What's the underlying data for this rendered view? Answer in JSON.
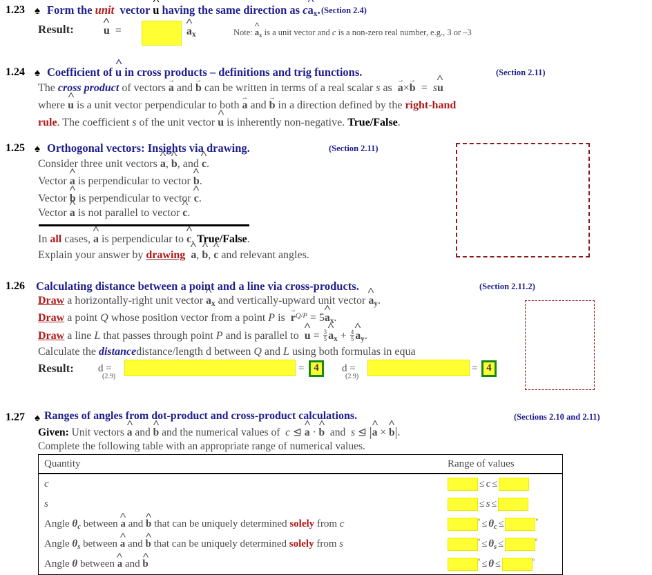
{
  "problems": [
    {
      "number": "1.23",
      "marker": "spade",
      "title_parts": [
        "Form the ",
        "unit",
        " vector ",
        "u",
        " having the same direction as ",
        "c",
        "a",
        "x",
        "."
      ],
      "title_plain": "Form the unit vector û having the same direction as c âx.",
      "section": "(Section 2.4)",
      "result_label": "Result:",
      "u_symbol": "u",
      "equals": "=",
      "ax_symbol": "a",
      "ax_sub": "x",
      "note": "Note:  âx is a unit vector and c is a non-zero real number, e.g., 3 or –3",
      "note_prefix": "Note:",
      "note_mid1": "is a unit vector and",
      "note_c": "c",
      "note_mid2": "is a non-zero real number, e.g., 3 or –3",
      "answer_box": ""
    },
    {
      "number": "1.24",
      "marker": "spade",
      "title_plain": "Coefficient of û in cross products – definitions and trig functions.",
      "title_a": "Coefficient of ",
      "title_u": "u",
      "title_b": " in cross products – definitions and trig functions.",
      "section": "(Section 2.11)",
      "line1_a": "The ",
      "line1_cross": "cross product",
      "line1_b": " of vectors ",
      "line1_c": " and ",
      "line1_d": " can be written in terms of a real scalar ",
      "line1_s": "s",
      "line1_e": " as ",
      "line2_a": "where ",
      "line2_b": " is a unit vector perpendicular to both ",
      "line2_c": " and ",
      "line2_d": " in a direction defined by the ",
      "line2_rh": "right-hand",
      "line3_rule": "rule",
      "line3_a": ".   The coefficient ",
      "line3_s": "s",
      "line3_b": " of the unit vector ",
      "line3_c": " is inherently non-negative.  ",
      "line3_tf": "True/False",
      "line3_period": "."
    },
    {
      "number": "1.25",
      "marker": "spade",
      "title_plain": "Orthogonal vectors:  Insights via drawing.",
      "section": "(Section 2.11)",
      "lines": [
        "Consider three unit vectors â, b̂, and ĉ.",
        "Vector â is perpendicular to vector b̂.",
        "Vector b̂ is perpendicular to vector ĉ.",
        "Vector â is not parallel to vector ĉ."
      ],
      "concl_a": "In ",
      "concl_all": "all",
      "concl_b": " cases, ",
      "concl_c": " is perpendicular to ",
      "concl_d": ".  ",
      "concl_tf": "True/False",
      "concl_e": ".",
      "explain_a": "Explain your answer by ",
      "explain_draw": "drawing",
      "explain_b": " â, b̂, ĉ and relevant angles.",
      "draw_area": "drawing-area"
    },
    {
      "number": "1.26",
      "marker": "none",
      "title_plain": "Calculating distance between a point and a line via cross-products.",
      "section": "(Section 2.11.2)",
      "l1_draw": "Draw",
      "l1_text": " a horizontally-right unit vector âx and vertically-upward unit vector ây.",
      "l2_draw": "Draw",
      "l2_a": " a point ",
      "l2_Q": "Q",
      "l2_b": " whose position vector from a point ",
      "l2_P": "P",
      "l2_c": " is ",
      "l2_d": " = 5",
      "l3_draw": "Draw",
      "l3_a": " a line ",
      "l3_L": "L",
      "l3_b": " that passes through point ",
      "l3_P": "P",
      "l3_c": " and is parallel to ",
      "l4_a": "Calculate the ",
      "l4_distance": "distance",
      "l4_b": "distance/length  d between ",
      "l4_Q": "Q",
      "l4_c": " and ",
      "l4_L": "L",
      "l4_d": " using both formulas in equa",
      "result_label": "Result:",
      "d_label": "d",
      "d_eq": "=",
      "d_ref": "(2.9)",
      "answer_box_1": "",
      "answer_box_2": "",
      "green_value_1": "4",
      "green_value_2": "4",
      "eq_sign_1": "=",
      "eq_sign_2": "=",
      "draw_area": "drawing-area"
    },
    {
      "number": "1.27",
      "marker": "spade",
      "title_plain": "Ranges of angles from dot-product and cross-product calculations.",
      "section": "(Sections 2.10 and 2.11)",
      "given_label": "Given:",
      "given_a": " Unit vectors ",
      "given_b": " and ",
      "given_c": " and the numerical values of ",
      "given_c_sym": "c",
      "given_d": " and ",
      "given_s_sym": "s",
      "given_end": ".",
      "complete": "Complete the following table with an appropriate range of numerical values.",
      "table": {
        "headers": [
          "Quantity",
          "Range of values"
        ],
        "rows": [
          {
            "quantity_plain": "c",
            "quantity_kind": "italic-symbol",
            "symbol": "c",
            "lo": "",
            "hi": "",
            "rel1": "≤",
            "mid": "c",
            "rel2": "≤",
            "degrees": false
          },
          {
            "quantity_plain": "s",
            "quantity_kind": "italic-symbol",
            "symbol": "s",
            "lo": "",
            "hi": "",
            "rel1": "≤",
            "mid": "s",
            "rel2": "≤",
            "degrees": false
          },
          {
            "quantity_plain": "Angle θc between â and b̂ that can be uniquely determined solely from c",
            "quantity_kind": "angle-c",
            "pre": "Angle ",
            "theta": "θ",
            "theta_sub": "c",
            "between": " between ",
            "and": " and ",
            "post": " that can be uniquely determined ",
            "solely": "solely",
            "from": " from ",
            "source": "c",
            "lo": "",
            "hi": "",
            "rel1": "≤",
            "rel2": "≤",
            "degrees": true
          },
          {
            "quantity_plain": "Angle θs between â and b̂ that can be uniquely determined solely from s",
            "quantity_kind": "angle-s",
            "pre": "Angle ",
            "theta": "θ",
            "theta_sub": "s",
            "between": " between ",
            "and": " and ",
            "post": " that can be uniquely determined ",
            "solely": "solely",
            "from": " from ",
            "source": "s",
            "lo": "",
            "hi": "",
            "rel1": "≤",
            "rel2": "≤",
            "degrees": true
          },
          {
            "quantity_plain": "Angle θ between â and b̂",
            "quantity_kind": "angle-plain",
            "pre": "Angle ",
            "theta": "θ",
            "theta_sub": "",
            "between": " between ",
            "and": " and ",
            "post": "",
            "solely": "",
            "from": "",
            "source": "",
            "lo": "",
            "hi": "",
            "rel1": "≤",
            "rel2": "≤",
            "degrees": true
          }
        ]
      }
    }
  ],
  "symbols": {
    "spade": "♠",
    "degree": "°",
    "cross": "×",
    "dot": "·",
    "leq": "≤",
    "triangleq": "≜",
    "equals": "=",
    "plus": "+"
  },
  "colors": {
    "title_blue": "#1f1f8f",
    "accent_red": "#b01818",
    "dashed_red": "#8b1a1a",
    "highlight_yellow": "#ffff33",
    "green_border": "#138a13",
    "body_grey": "#4a4a4a"
  }
}
